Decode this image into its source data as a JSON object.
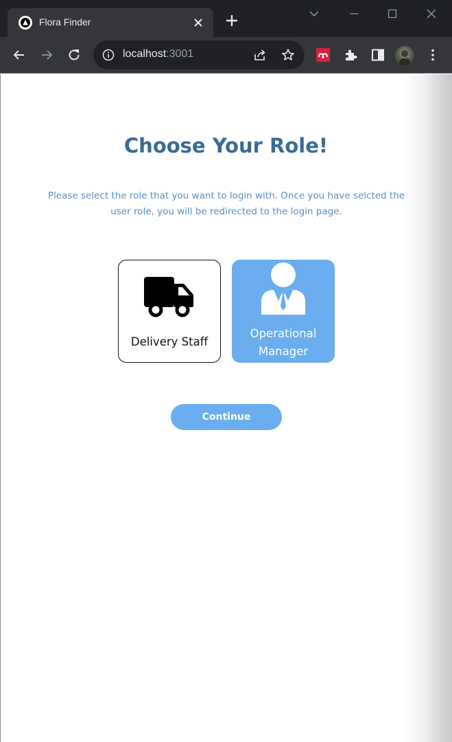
{
  "browser": {
    "tab_title": "Flora Finder",
    "url_host": "localhost",
    "url_port": ":3001",
    "icons": [
      "vercel-favicon-icon",
      "close-tab-icon",
      "new-tab-icon",
      "tab-search-icon",
      "minimize-icon",
      "maximize-icon",
      "close-window-icon",
      "back-icon",
      "forward-icon",
      "reload-icon",
      "site-info-icon",
      "share-icon",
      "bookmark-star-icon",
      "mendeley-extension-icon",
      "extensions-icon",
      "side-panel-icon",
      "profile-avatar",
      "menu-icon"
    ]
  },
  "page": {
    "title": "Choose Your Role!",
    "subtitle": "Please select the role that you want to login with. Once you have selcted the user role, you will be redirected to the login page.",
    "roles": [
      {
        "label": "Delivery Staff",
        "icon": "truck-icon",
        "selected": false
      },
      {
        "label": "Operational Manager",
        "icon": "manager-person-icon",
        "selected": true
      }
    ],
    "continue_label": "Continue"
  },
  "colors": {
    "title": "#3b6a96",
    "subtitle": "#5b8fc6",
    "accent": "#6aaeef",
    "chrome_dark": "#202124",
    "chrome_toolbar": "#35363a"
  }
}
